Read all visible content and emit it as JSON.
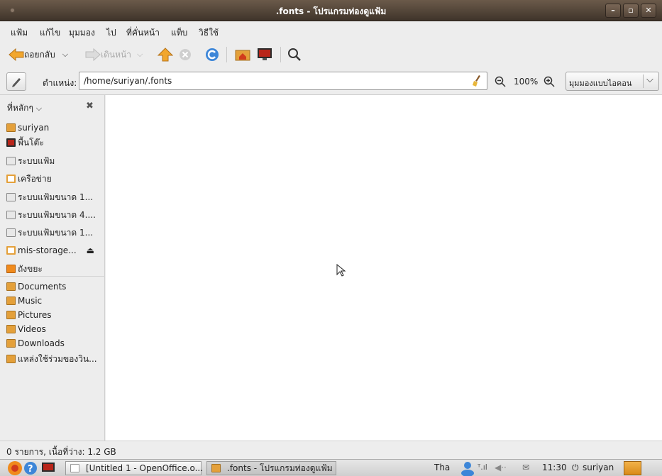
{
  "window": {
    "title": ".fonts - โปรแกรมท่องดูแฟ้ม"
  },
  "menu": [
    "แฟ้ม",
    "แก้ไข",
    "มุมมอง",
    "ไป",
    "ที่คั่นหน้า",
    "แท็บ",
    "วิธีใช้"
  ],
  "toolbar": {
    "back_label": "ถอยกลับ",
    "forward_label": "เดินหน้า"
  },
  "location": {
    "label": "ตำแหน่ง:",
    "path": "/home/suriyan/.fonts",
    "zoom": "100%",
    "view_mode": "มุมมองแบบไอคอน"
  },
  "sidebar": {
    "header": "ที่หลักๆ",
    "places": [
      {
        "label": "suriyan",
        "icon": "home-folder-icon"
      },
      {
        "label": "พื้นโต๊ะ",
        "icon": "desktop-icon"
      },
      {
        "label": "ระบบแฟ้ม",
        "icon": "drive-icon"
      },
      {
        "label": "เครือข่าย",
        "icon": "network-icon"
      },
      {
        "label": "ระบบแฟ้มขนาด 1...",
        "icon": "drive-icon"
      },
      {
        "label": "ระบบแฟ้มขนาด 4....",
        "icon": "drive-icon"
      },
      {
        "label": "ระบบแฟ้มขนาด 1...",
        "icon": "drive-icon"
      },
      {
        "label": "mis-storage...",
        "icon": "network-share-icon"
      },
      {
        "label": "ถังขยะ",
        "icon": "trash-icon"
      }
    ],
    "bookmarks": [
      {
        "label": "Documents",
        "icon": "documents-folder-icon"
      },
      {
        "label": "Music",
        "icon": "music-folder-icon"
      },
      {
        "label": "Pictures",
        "icon": "pictures-folder-icon"
      },
      {
        "label": "Videos",
        "icon": "videos-folder-icon"
      },
      {
        "label": "Downloads",
        "icon": "downloads-folder-icon"
      },
      {
        "label": "แหล่งใช้ร่วมของวิน...",
        "icon": "folder-icon"
      }
    ]
  },
  "status": {
    "text": "0 รายการ, เนื้อที่ว่าง: 1.2 GB"
  },
  "taskbar": {
    "tasks": [
      "[Untitled 1 - OpenOffice.o...",
      ".fonts - โปรแกรมท่องดูแฟ้ม"
    ],
    "keyboard": "Tha",
    "time": "11:30",
    "user": "suriyan"
  },
  "colors": {
    "titlebar": "#4f4236",
    "folder": "#e4a03a",
    "accent_orange": "#f08a1c"
  }
}
